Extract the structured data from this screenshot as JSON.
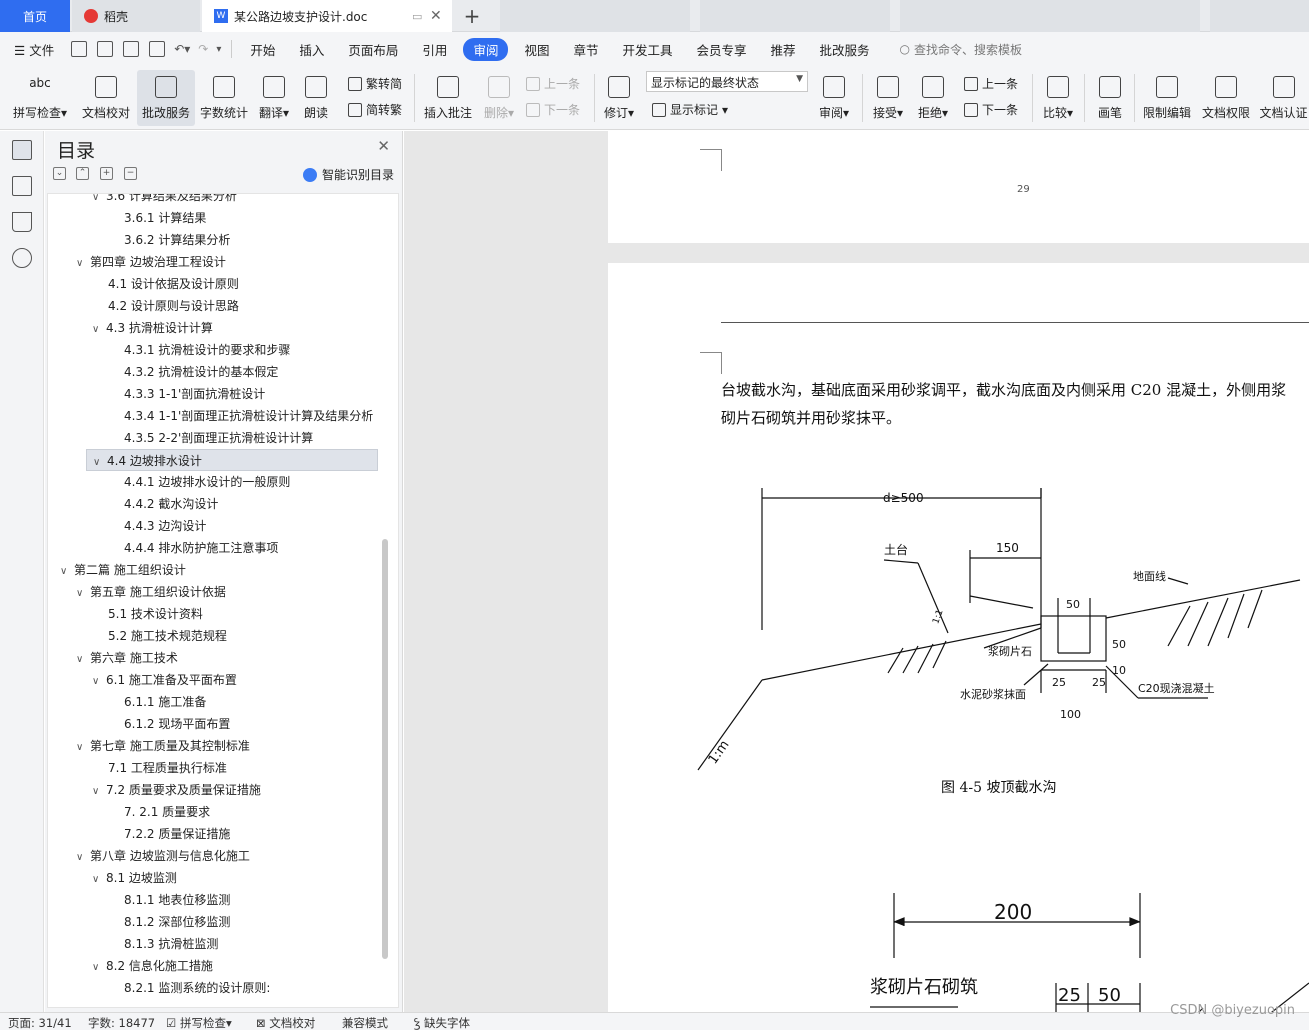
{
  "tabs": {
    "home": "首页",
    "daoke": "稻壳",
    "doc": "某公路边坡支护设计.doc"
  },
  "menu": {
    "file": "文件",
    "items": [
      "开始",
      "插入",
      "页面布局",
      "引用",
      "审阅",
      "视图",
      "章节",
      "开发工具",
      "会员专享",
      "推荐",
      "批改服务"
    ],
    "active": "审阅",
    "search": "查找命令、搜索模板"
  },
  "ribbon": {
    "spellcheck": "拼写检查",
    "doc_proof": "文档校对",
    "correction_service": "批改服务",
    "word_count": "字数统计",
    "translate": "翻译",
    "read_aloud": "朗读",
    "trad_to_simp": "繁转简",
    "simp_to_trad": "简转繁",
    "insert_comment": "插入批注",
    "delete": "删除",
    "prev": "上一条",
    "next": "下一条",
    "track_changes": "修订",
    "markup_state": "显示标记的最终状态",
    "show_markup": "显示标记",
    "review": "审阅",
    "accept": "接受",
    "reject": "拒绝",
    "prev2": "上一条",
    "next2": "下一条",
    "compare": "比较",
    "pen": "画笔",
    "restrict_edit": "限制编辑",
    "doc_permission": "文档权限",
    "doc_certify": "文档认证"
  },
  "toc": {
    "title": "目录",
    "smart": "智能识别目录",
    "items": [
      {
        "level": 3,
        "chev": "v",
        "text": "3.6  计算结果及结果分析"
      },
      {
        "level": 4,
        "chev": "",
        "text": "3.6.1 计算结果"
      },
      {
        "level": 4,
        "chev": "",
        "text": "3.6.2  计算结果分析"
      },
      {
        "level": 2,
        "chev": "v",
        "text": "第四章    边坡治理工程设计"
      },
      {
        "level": 3,
        "chev": "",
        "text": "4.1 设计依据及设计原则"
      },
      {
        "level": 3,
        "chev": "",
        "text": "4.2  设计原则与设计思路"
      },
      {
        "level": 3,
        "chev": "v",
        "text": "4.3  抗滑桩设计计算"
      },
      {
        "level": 4,
        "chev": "",
        "text": "4.3.1 抗滑桩设计的要求和步骤"
      },
      {
        "level": 4,
        "chev": "",
        "text": "4.3.2 抗滑桩设计的基本假定"
      },
      {
        "level": 4,
        "chev": "",
        "text": "4.3.3 1-1'剖面抗滑桩设计"
      },
      {
        "level": 4,
        "chev": "",
        "text": "4.3.4    1-1'剖面理正抗滑桩设计计算及结果分析"
      },
      {
        "level": 4,
        "chev": "",
        "text": "4.3.5 2-2'剖面理正抗滑桩设计计算"
      },
      {
        "level": 3,
        "chev": "v",
        "text": "4.4  边坡排水设计",
        "selected": true
      },
      {
        "level": 4,
        "chev": "",
        "text": "4.4.1 边坡排水设计的一般原则"
      },
      {
        "level": 4,
        "chev": "",
        "text": "4.4.2 截水沟设计"
      },
      {
        "level": 4,
        "chev": "",
        "text": "4.4.3 边沟设计"
      },
      {
        "level": 4,
        "chev": "",
        "text": "4.4.4 排水防护施工注意事项"
      },
      {
        "level": 1,
        "chev": "v",
        "text": "第二篇  施工组织设计"
      },
      {
        "level": 2,
        "chev": "v",
        "text": "第五章    施工组织设计依据"
      },
      {
        "level": 3,
        "chev": "",
        "text": "5.1  技术设计资料"
      },
      {
        "level": 3,
        "chev": "",
        "text": "5.2  施工技术规范规程"
      },
      {
        "level": 2,
        "chev": "v",
        "text": "第六章    施工技术"
      },
      {
        "level": 3,
        "chev": "v",
        "text": "6.1  施工准备及平面布置"
      },
      {
        "level": 4,
        "chev": "",
        "text": "6.1.1 施工准备"
      },
      {
        "level": 4,
        "chev": "",
        "text": "6.1.2 现场平面布置"
      },
      {
        "level": 2,
        "chev": "v",
        "text": "第七章    施工质量及其控制标准"
      },
      {
        "level": 3,
        "chev": "",
        "text": "7.1 工程质量执行标准"
      },
      {
        "level": 3,
        "chev": "v",
        "text": "7.2  质量要求及质量保证措施"
      },
      {
        "level": 4,
        "chev": "",
        "text": "7. 2.1 质量要求"
      },
      {
        "level": 4,
        "chev": "",
        "text": "7.2.2  质量保证措施"
      },
      {
        "level": 2,
        "chev": "v",
        "text": "第八章    边坡监测与信息化施工"
      },
      {
        "level": 3,
        "chev": "v",
        "text": "8.1  边坡监测"
      },
      {
        "level": 4,
        "chev": "",
        "text": "8.1.1 地表位移监测"
      },
      {
        "level": 4,
        "chev": "",
        "text": "8.1.2 深部位移监测"
      },
      {
        "level": 4,
        "chev": "",
        "text": "8.1.3 抗滑桩监测"
      },
      {
        "level": 3,
        "chev": "v",
        "text": "8.2 信息化施工措施"
      },
      {
        "level": 4,
        "chev": "",
        "text": "8.2.1 监测系统的设计原则:"
      }
    ]
  },
  "doc": {
    "page_number": "29",
    "para_line1": "台坡截水沟，基础底面采用砂浆调平，截水沟底面及内侧采用 C20 混凝土，外侧用浆",
    "para_line2": "砌片石砌筑并用砂浆抹平。",
    "fig1": {
      "caption": "图 4-5    坡顶截水沟",
      "d500": "d≥500",
      "tutai": "土台",
      "dim150": "150",
      "dimaoxian": "地面线",
      "dim50": "50",
      "slope11": "1:1",
      "jiangqi": "浆砌片石",
      "dim50v": "50",
      "dim10": "10",
      "dim25a": "25",
      "dim25b": "25",
      "shuini": "水泥砂浆抹面",
      "c20": "C20现浇混凝土",
      "dim100": "100",
      "slope1m": "1:m"
    },
    "fig2": {
      "dim200": "200",
      "jiangqi": "浆砌片石砌筑",
      "dim25": "25",
      "dim50": "50"
    }
  },
  "status": {
    "page": "页面: 31/41",
    "words": "字数: 18477",
    "spell": "拼写检查",
    "proof": "文档校对",
    "compat": "兼容模式",
    "missing_font": "缺失字体"
  },
  "watermark": "CSDN @biyezuopin"
}
